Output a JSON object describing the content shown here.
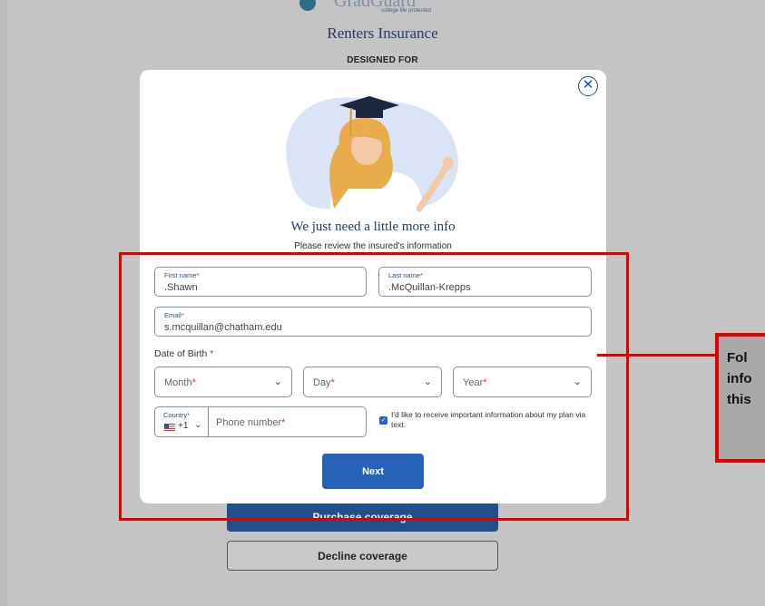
{
  "brand": {
    "tagline": "college life protected"
  },
  "background": {
    "title": "Renters Insurance",
    "designed_for": "DESIGNED FOR",
    "purchase_label": "Purchase coverage",
    "decline_label": "Decline coverage"
  },
  "modal": {
    "close_icon": "close-icon",
    "title": "We just need a little more info",
    "subtitle": "Please review the insured's information",
    "first_name": {
      "label": "First name",
      "value": ".Shawn"
    },
    "last_name": {
      "label": "Last name",
      "value": ".McQuillan-Krepps"
    },
    "email": {
      "label": "Email",
      "value": "s.mcquillan@chatham.edu"
    },
    "dob": {
      "label": "Date of Birth",
      "month": "Month",
      "day": "Day",
      "year": "Year"
    },
    "required_mark": "*",
    "phone": {
      "country_label": "Country",
      "country_code": "+1",
      "flag_icon": "us-flag-icon",
      "placeholder": "Phone number"
    },
    "sms_optin": {
      "checked": true,
      "label": "I'd like to receive important information about my plan via text."
    },
    "next_label": "Next"
  },
  "annotation": {
    "text": "Fol\ninfo\nthis",
    "color": "#e00000"
  }
}
